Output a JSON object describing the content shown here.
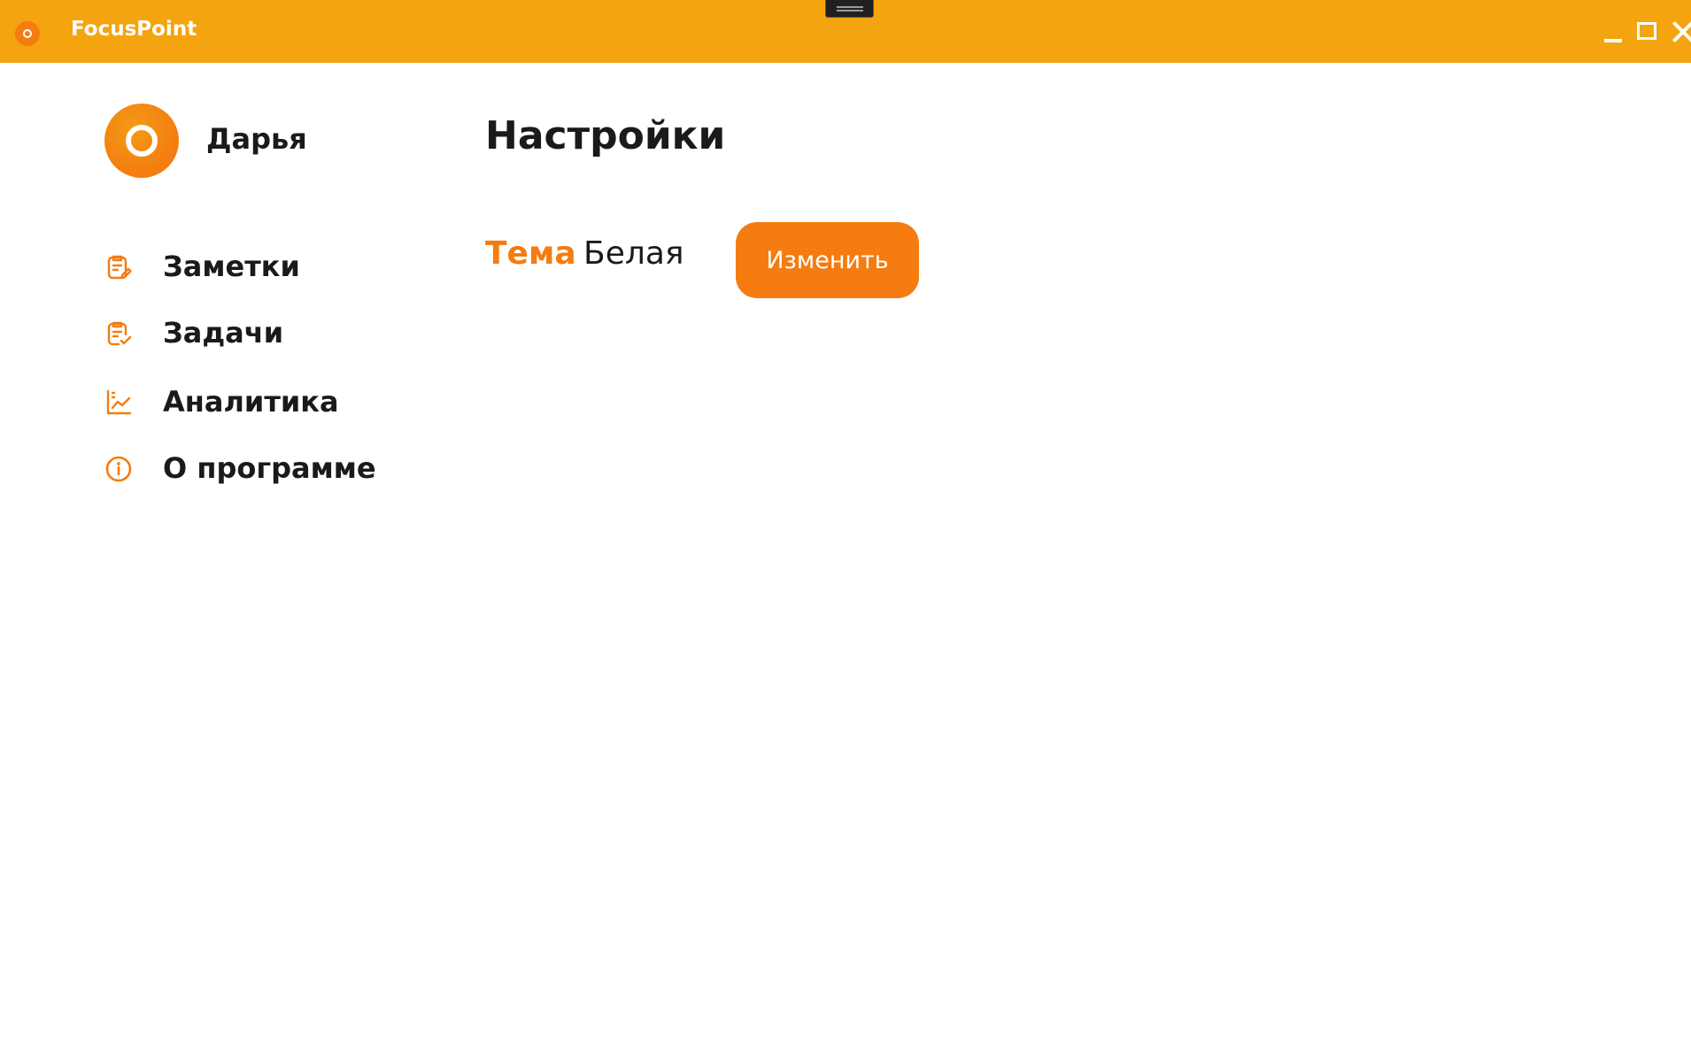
{
  "app": {
    "title": "FocusPoint",
    "accent_color": "#f47c10",
    "titlebar_color": "#f4a40f"
  },
  "window_controls": {
    "minimize_icon": "minimize-icon",
    "maximize_icon": "maximize-icon",
    "close_icon": "close-icon"
  },
  "user": {
    "name": "Дарья",
    "avatar_icon": "ring-icon"
  },
  "sidebar": {
    "items": [
      {
        "label": "Заметки",
        "icon": "notes-icon"
      },
      {
        "label": "Задачи",
        "icon": "tasks-icon"
      },
      {
        "label": "Аналитика",
        "icon": "chart-icon"
      },
      {
        "label": "О программе",
        "icon": "info-icon"
      }
    ]
  },
  "main": {
    "title": "Настройки",
    "theme": {
      "label": "Тема",
      "value": "Белая",
      "change_label": "Изменить"
    }
  }
}
